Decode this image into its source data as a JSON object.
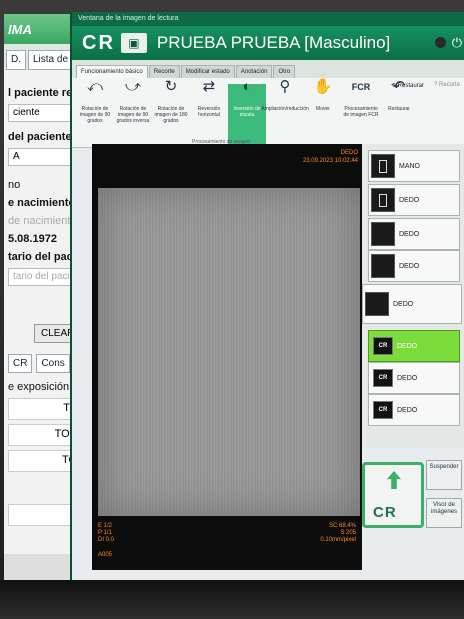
{
  "background_app": {
    "title": "IMA",
    "tabs": [
      "D.",
      "Lista de e"
    ],
    "labels": [
      "l paciente re",
      "ciente",
      "del paciente",
      "A",
      "no",
      "e nacimiento",
      "de nacimiento",
      "5.08.1972",
      "tario del pacier",
      "tario del pacie"
    ],
    "clear_label": "CLEAR",
    "tab2": [
      "CR",
      "Cons"
    ],
    "exposure_label": "e exposición",
    "rows": [
      "TOF",
      "TORA",
      "TOR",
      "C"
    ]
  },
  "window": {
    "caption": "Ventana de la imagen de lectura",
    "brand": "CR",
    "patient_name": "PRUEBA  PRUEBA [Masculino]",
    "tabs": [
      "Funcionamiento básico",
      "Recorte",
      "Modificar estado",
      "Anotación",
      "Otro"
    ],
    "tools": [
      {
        "icon": "rotate-left-icon",
        "label": "Rotación de imagen de 90 grados"
      },
      {
        "icon": "rotate-right-icon",
        "label": "Rotación de imagen de 90 grados inversa"
      },
      {
        "icon": "rotate-180-icon",
        "label": "Rotación de imagen de 180 grados"
      },
      {
        "icon": "flip-icon",
        "label": "Reversión horizontal"
      },
      {
        "icon": "invert-icon",
        "label": "Inversión de escala"
      },
      {
        "icon": "zoom-icon",
        "label": "Ampliación/reducción"
      },
      {
        "icon": "hand-icon",
        "label": "Mover"
      },
      {
        "icon": "fcr-icon",
        "label": "Procesamiento de imagen FCR"
      },
      {
        "icon": "undo-icon",
        "label": "Restaurar"
      }
    ],
    "toolbar_group_label": "Procesamiento de imagen",
    "restore_label": "Restaurar",
    "help_label": "Recorte"
  },
  "viewer": {
    "top_right": [
      "DEDO",
      "23.09.2023 10:02:44"
    ],
    "bottom_left": [
      "E 1/2",
      "P 1/1",
      "DI 0.0"
    ],
    "bottom_right": [
      "SC 68.4%",
      "S 205",
      "0.10mm/pixel"
    ],
    "code": "A005"
  },
  "thumbnails": [
    {
      "label": "MANO",
      "selected": false
    },
    {
      "label": "DEDO",
      "selected": false
    },
    {
      "label": "DEDO",
      "selected": false
    },
    {
      "label": "DEDO",
      "selected": false
    },
    {
      "label": "DEDO",
      "selected": false
    },
    {
      "label": "DEDO",
      "selected": true
    },
    {
      "label": "DEDO",
      "selected": false
    },
    {
      "label": "DEDO",
      "selected": false
    }
  ],
  "actions": {
    "cr_button": "CR",
    "suspend_label": "Suspender",
    "viewer_label": "Visor de imágenes"
  }
}
